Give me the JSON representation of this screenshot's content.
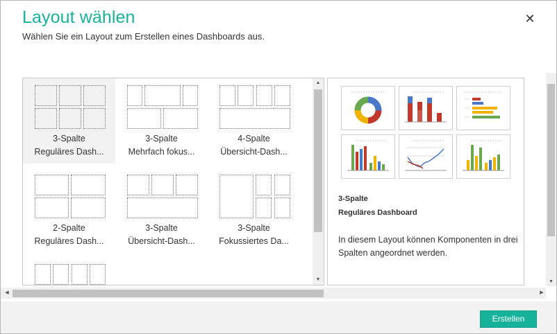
{
  "dialog": {
    "title": "Layout wählen",
    "subtitle": "Wählen Sie ein Layout zum Erstellen eines Dashboards aus.",
    "close_glyph": "✕"
  },
  "layouts": [
    {
      "line1": "3-Spalte",
      "line2": "Reguläres Dash...",
      "selected": true
    },
    {
      "line1": "3-Spalte",
      "line2": "Mehrfach fokus...",
      "selected": false
    },
    {
      "line1": "4-Spalte",
      "line2": "Übersicht-Dash...",
      "selected": false
    },
    {
      "line1": "2-Spalte",
      "line2": "Reguläres Dash...",
      "selected": false
    },
    {
      "line1": "3-Spalte",
      "line2": "Übersicht-Dash...",
      "selected": false
    },
    {
      "line1": "3-Spalte",
      "line2": "Fokussiertes Da...",
      "selected": false
    }
  ],
  "preview": {
    "name": "3-Spalte",
    "type": "Reguläres Dashboard",
    "description": "In diesem Layout können Komponenten in drei Spalten angeordnet werden."
  },
  "footer": {
    "create_label": "Erstellen"
  },
  "colors": {
    "accent": "#16b39a",
    "chart_red": "#c0392b",
    "chart_blue": "#4a78c8",
    "chart_yellow": "#f0b400",
    "chart_green": "#6aa84f"
  },
  "icons": {
    "close": "close-icon",
    "scroll_up": "arrow-up-icon",
    "scroll_down": "arrow-down-icon",
    "scroll_left": "arrow-left-icon",
    "scroll_right": "arrow-right-icon"
  }
}
